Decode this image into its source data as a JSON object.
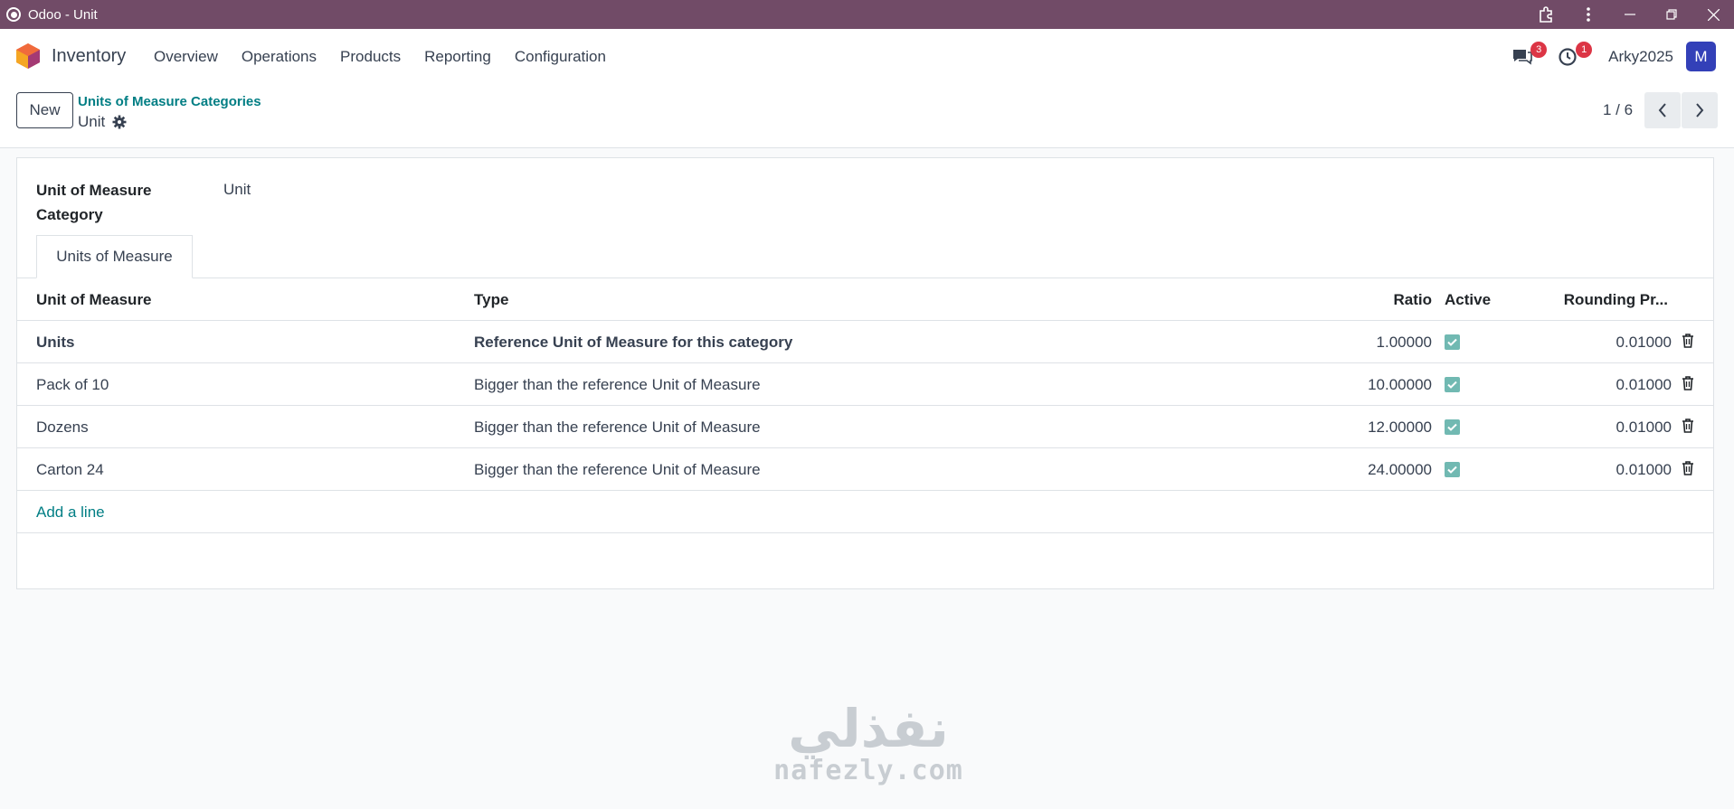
{
  "window": {
    "title": "Odoo - Unit"
  },
  "nav": {
    "app_name": "Inventory",
    "menu": [
      "Overview",
      "Operations",
      "Products",
      "Reporting",
      "Configuration"
    ],
    "messages_count": "3",
    "activities_count": "1",
    "username": "Arky2025",
    "avatar_letter": "M"
  },
  "control": {
    "new_label": "New",
    "breadcrumb_parent": "Units of Measure Categories",
    "breadcrumb_current": "Unit",
    "pager": "1 / 6"
  },
  "form": {
    "category_label": "Unit of Measure Category",
    "category_value": "Unit",
    "tab_label": "Units of Measure",
    "columns": {
      "uom": "Unit of Measure",
      "type": "Type",
      "ratio": "Ratio",
      "active": "Active",
      "rounding": "Rounding Pr..."
    },
    "rows": [
      {
        "uom": "Units",
        "type": "Reference Unit of Measure for this category",
        "ratio": "1.00000",
        "active": true,
        "rounding": "0.01000"
      },
      {
        "uom": "Pack of 10",
        "type": "Bigger than the reference Unit of Measure",
        "ratio": "10.00000",
        "active": true,
        "rounding": "0.01000"
      },
      {
        "uom": "Dozens",
        "type": "Bigger than the reference Unit of Measure",
        "ratio": "12.00000",
        "active": true,
        "rounding": "0.01000"
      },
      {
        "uom": "Carton 24",
        "type": "Bigger than the reference Unit of Measure",
        "ratio": "24.00000",
        "active": true,
        "rounding": "0.01000"
      }
    ],
    "add_line_label": "Add a line"
  },
  "watermark": {
    "arabic": "نفذلي",
    "latin": "nafezly.com"
  },
  "colors": {
    "titlebar": "#714b67",
    "link": "#017e84",
    "checkbox": "#71b9b2",
    "badge": "#dc3545",
    "avatar": "#3340b8"
  }
}
